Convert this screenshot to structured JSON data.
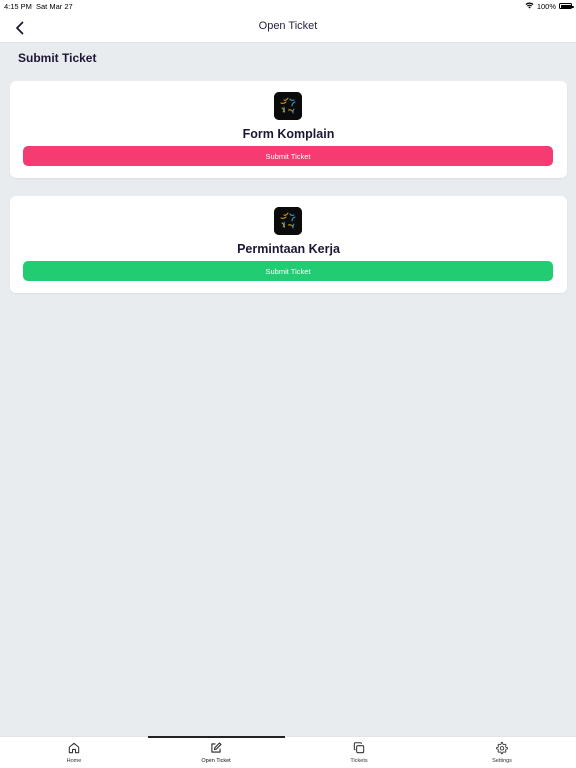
{
  "status_bar": {
    "time": "4:15 PM",
    "date": "Sat Mar 27",
    "battery": "100%",
    "icons": [
      "wifi-icon",
      "battery-icon"
    ]
  },
  "nav": {
    "title": "Open Ticket",
    "back_icon": "chevron-left-icon"
  },
  "section": {
    "title": "Submit Ticket"
  },
  "cards": [
    {
      "title": "Form Komplain",
      "button_label": "Submit Ticket",
      "button_color": "#f63a72",
      "logo_icon": "app-logo-icon"
    },
    {
      "title": "Permintaan Kerja",
      "button_label": "Submit Ticket",
      "button_color": "#21cc73",
      "logo_icon": "app-logo-icon"
    }
  ],
  "tabs": [
    {
      "label": "Home",
      "icon": "home-icon",
      "active": false
    },
    {
      "label": "Open Ticket",
      "icon": "edit-icon",
      "active": true
    },
    {
      "label": "Tickets",
      "icon": "copy-icon",
      "active": false
    },
    {
      "label": "Settings",
      "icon": "gear-icon",
      "active": false
    }
  ],
  "colors": {
    "background": "#e9ecef",
    "text_primary": "#1d1635",
    "pink": "#f63a72",
    "green": "#21cc73"
  }
}
